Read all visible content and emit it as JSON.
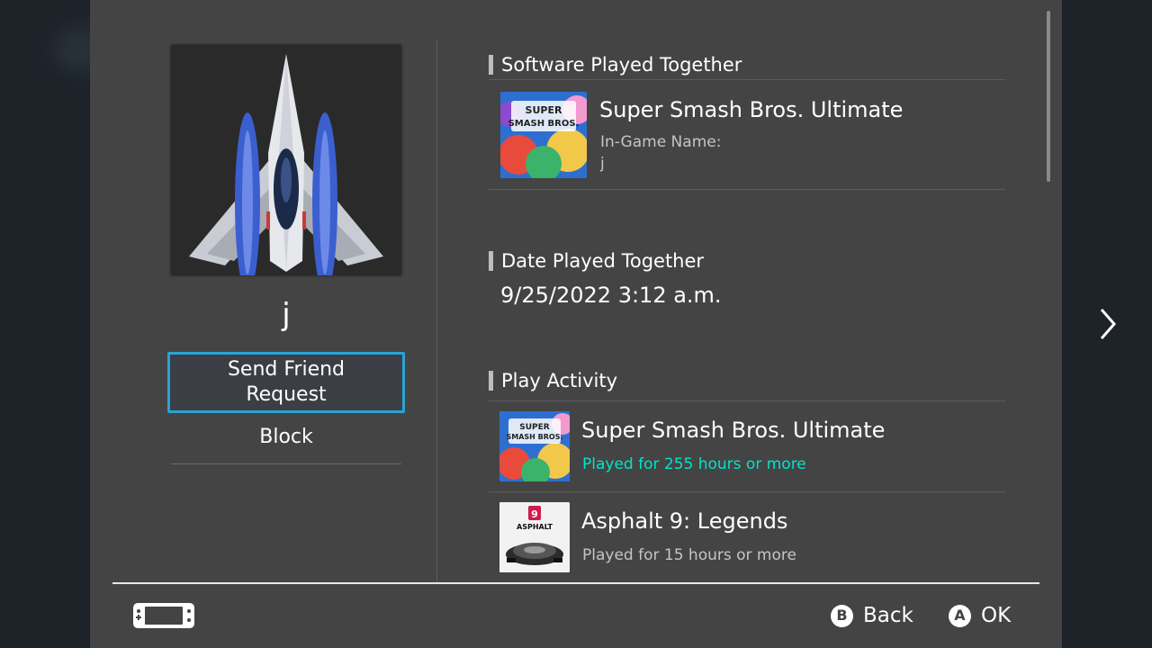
{
  "user": {
    "name": "j",
    "send_friend_request_label": "Send Friend Request",
    "block_label": "Block"
  },
  "software_section": {
    "header": "Software Played Together",
    "game_title": "Super Smash Bros. Ultimate",
    "in_game_name_label": "In-Game Name:",
    "in_game_name_value": "j",
    "thumb_text": [
      "SUPER",
      "SMASH BROS."
    ]
  },
  "date_section": {
    "header": "Date Played Together",
    "value": "9/25/2022 3:12 a.m."
  },
  "activity_section": {
    "header": "Play Activity",
    "items": [
      {
        "title": "Super Smash Bros. Ultimate",
        "playtime": "Played for 255 hours or more",
        "highlight": true
      },
      {
        "title": "Asphalt 9: Legends",
        "playtime": "Played for 15 hours or more",
        "highlight": false,
        "thumb_text": [
          "9",
          "ASPHALT"
        ]
      }
    ]
  },
  "footer": {
    "back_symbol": "B",
    "back_label": "Back",
    "ok_symbol": "A",
    "ok_label": "OK"
  },
  "colors": {
    "panel_bg": "#444444",
    "accent_highlight": "#00e5c8",
    "focus_border": "#29a3d6",
    "muted_text": "#c5c5c5"
  }
}
